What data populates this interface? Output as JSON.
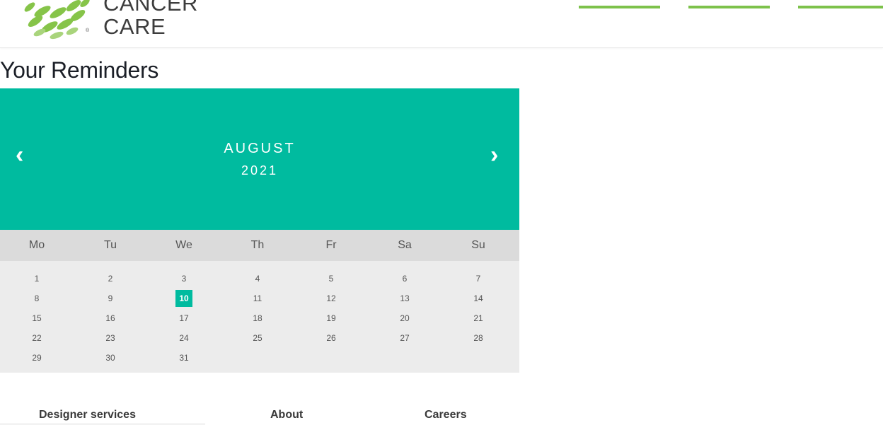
{
  "header": {
    "logo_line1": "CANCER",
    "logo_line2": "CARE",
    "logo_reg": "®",
    "brand_color": "#7dc24b"
  },
  "page": {
    "title": "Your Reminders"
  },
  "calendar": {
    "month": "AUGUST",
    "year": "2021",
    "prev_icon": "‹",
    "next_icon": "›",
    "accent_color": "#00bb9f",
    "weekdays": [
      "Mo",
      "Tu",
      "We",
      "Th",
      "Fr",
      "Sa",
      "Su"
    ],
    "weeks": [
      [
        "1",
        "2",
        "3",
        "4",
        "5",
        "6",
        "7"
      ],
      [
        "8",
        "9",
        "10",
        "11",
        "12",
        "13",
        "14"
      ],
      [
        "15",
        "16",
        "17",
        "18",
        "19",
        "20",
        "21"
      ],
      [
        "22",
        "23",
        "24",
        "25",
        "26",
        "27",
        "28"
      ],
      [
        "29",
        "30",
        "31",
        "",
        "",
        "",
        ""
      ]
    ],
    "today": "10"
  },
  "footer": {
    "links": [
      "Designer services",
      "About",
      "Careers"
    ]
  }
}
